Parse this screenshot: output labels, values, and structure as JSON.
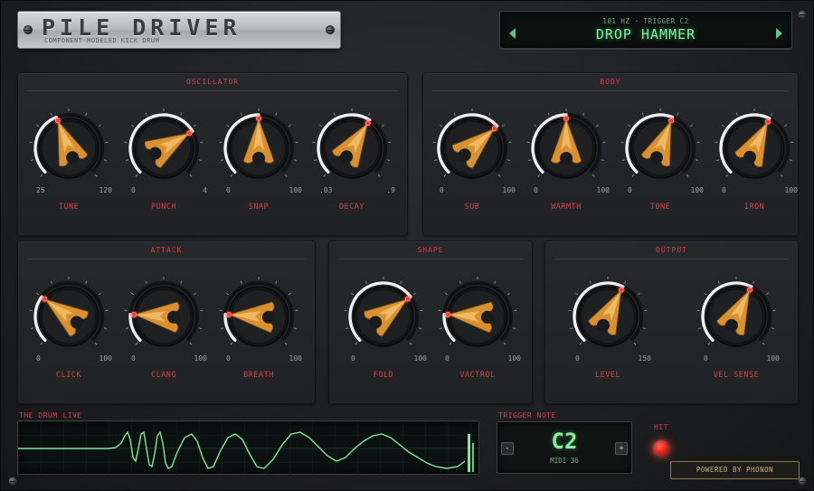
{
  "brand": {
    "title": "PILE DRIVER",
    "subtitle": "COMPONENT-MODELED KICK DRUM"
  },
  "preset": {
    "sub": "101 HZ · TRIGGER C2",
    "name": "DROP HAMMER"
  },
  "sections": [
    {
      "title": "OSCILLATOR",
      "knobs": [
        {
          "label": "TUNE",
          "min": "25",
          "max": "120",
          "value": 0.42
        },
        {
          "label": "PUNCH",
          "min": "0",
          "max": "4",
          "value": 0.72
        },
        {
          "label": "SNAP",
          "min": "0",
          "max": "100",
          "value": 0.5
        },
        {
          "label": "DECAY",
          "min": ".03",
          "max": ".9",
          "value": 0.62
        }
      ]
    },
    {
      "title": "BODY",
      "knobs": [
        {
          "label": "SUB",
          "min": "0",
          "max": "100",
          "value": 0.68
        },
        {
          "label": "WARMTH",
          "min": "0",
          "max": "100",
          "value": 0.5
        },
        {
          "label": "TONE",
          "min": "0",
          "max": "100",
          "value": 0.58
        },
        {
          "label": "IRON",
          "min": "0",
          "max": "100",
          "value": 0.6
        }
      ]
    },
    {
      "title": "ATTACK",
      "knobs": [
        {
          "label": "CLICK",
          "min": "0",
          "max": "100",
          "value": 0.3
        },
        {
          "label": "CLANG",
          "min": "0",
          "max": "100",
          "value": 0.18
        },
        {
          "label": "BREATH",
          "min": "0",
          "max": "100",
          "value": 0.18
        }
      ]
    },
    {
      "title": "SHAPE",
      "knobs": [
        {
          "label": "FOLD",
          "min": "0",
          "max": "100",
          "value": 0.7
        },
        {
          "label": "VACTROL",
          "min": "0",
          "max": "100",
          "value": 0.18
        }
      ]
    },
    {
      "title": "OUTPUT",
      "knobs": [
        {
          "label": "LEVEL",
          "min": "0",
          "max": "150",
          "value": 0.6
        },
        {
          "label": "VEL SENSE",
          "min": "0",
          "max": "100",
          "value": 0.6
        }
      ]
    }
  ],
  "scope": {
    "label": "THE DRUM",
    "live": "LIVE"
  },
  "trigger": {
    "label": "TRIGGER NOTE",
    "note": "C2",
    "midi": "MIDI 36",
    "minus": "-",
    "plus": "+"
  },
  "hit": {
    "label": "HIT"
  },
  "footer": {
    "powered": "POWERED BY PHONON"
  },
  "colors": {
    "accent_red": "#d0444a",
    "lcd_green": "#86f0a0",
    "knob_gold": "#d9912f",
    "led_red": "#ff3b30"
  }
}
